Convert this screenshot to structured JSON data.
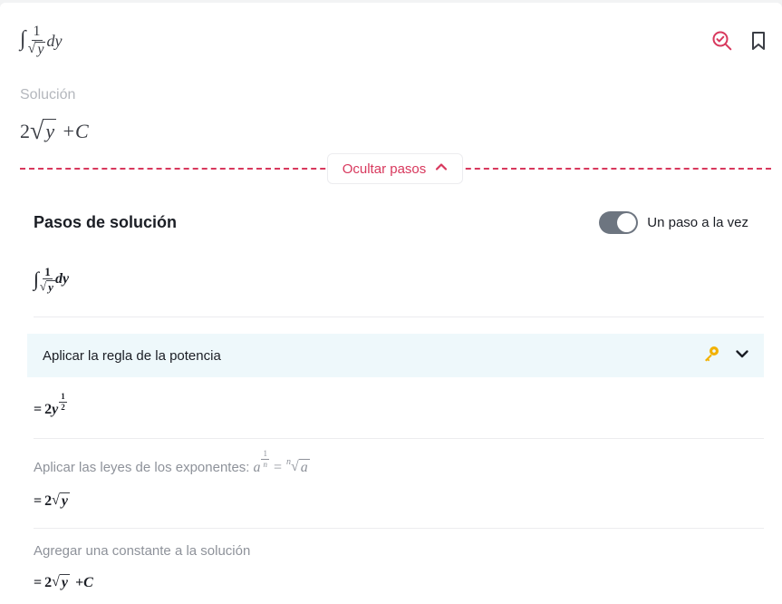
{
  "problem": {
    "integral": "∫",
    "numerator": "1",
    "radical": "√",
    "variable": "y",
    "differential": "dy"
  },
  "solution": {
    "label": "Solución",
    "coef": "2",
    "variable": "y",
    "plus_c": "+C"
  },
  "toggle": {
    "label": "Ocultar pasos"
  },
  "steps": {
    "title": "Pasos de solución",
    "one_at_a_time": "Un paso a la vez",
    "one_at_a_time_on": true,
    "initial": {
      "integral": "∫",
      "numerator": "1",
      "variable": "y",
      "differential": "dy"
    },
    "rule": {
      "label": "Aplicar la regla de la potencia"
    },
    "after_rule": {
      "eq": "=",
      "coef": "2",
      "base": "y",
      "exp_num": "1",
      "exp_den": "2"
    },
    "note_exponents": {
      "label": "Aplicar las leyes de los exponentes:",
      "base": "a",
      "exp_num": "1",
      "exp_den": "n",
      "eq": "=",
      "index": "n",
      "radicand": "a"
    },
    "after_exponents": {
      "eq": "=",
      "coef": "2",
      "variable": "y"
    },
    "note_constant": {
      "label": "Agregar una constante a la solución"
    },
    "final": {
      "eq": "=",
      "coef": "2",
      "variable": "y",
      "plus_c": "+C"
    }
  },
  "colors": {
    "accent": "#d8385d",
    "rule_bg": "#eef8fb",
    "key": "#f2b100"
  },
  "icons": [
    "search-check-icon",
    "bookmark-icon",
    "chevron-up-icon",
    "key-icon",
    "chevron-down-icon"
  ]
}
